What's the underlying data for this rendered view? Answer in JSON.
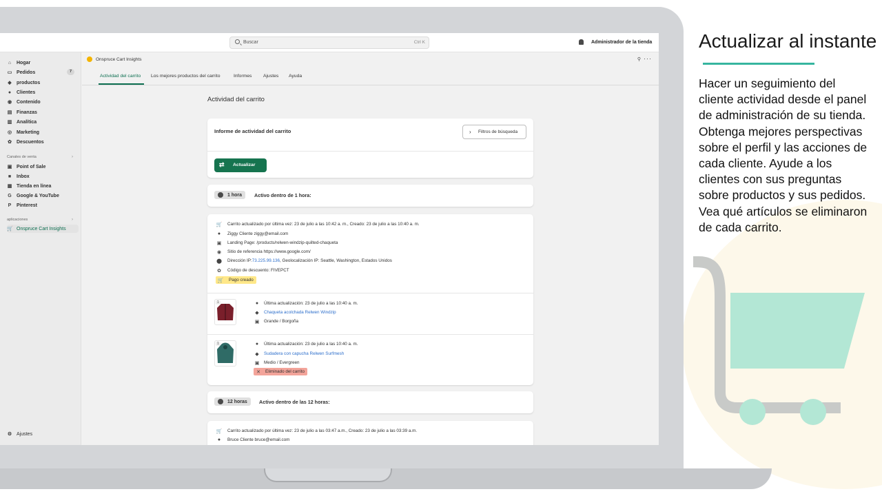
{
  "topbar": {
    "search_placeholder": "Buscar",
    "search_shortcut": "Ctrl K",
    "store_admin": "Administrador de la tienda"
  },
  "sidebar": {
    "items": [
      {
        "label": "Hogar",
        "icon": "home-icon"
      },
      {
        "label": "Pedidos",
        "icon": "orders-icon",
        "badge": "7"
      },
      {
        "label": "productos",
        "icon": "tag-icon"
      },
      {
        "label": "Clientes",
        "icon": "person-icon"
      },
      {
        "label": "Contenido",
        "icon": "content-icon"
      },
      {
        "label": "Finanzas",
        "icon": "finance-icon"
      },
      {
        "label": "Analítica",
        "icon": "analytics-icon"
      },
      {
        "label": "Marketing",
        "icon": "marketing-icon"
      },
      {
        "label": "Descuentos",
        "icon": "discount-icon"
      }
    ],
    "sales_channels_label": "Canales de venta",
    "sales_channels": [
      {
        "label": "Point of Sale",
        "icon": "pos-icon"
      },
      {
        "label": "Inbox",
        "icon": "inbox-icon"
      },
      {
        "label": "Tienda en línea",
        "icon": "store-icon"
      },
      {
        "label": "Google & YouTube",
        "icon": "google-icon"
      },
      {
        "label": "Pinterest",
        "icon": "pinterest-icon"
      }
    ],
    "apps_label": "aplicaciones",
    "apps": [
      {
        "label": "Onspruce Cart Insights",
        "icon": "cart-icon"
      }
    ],
    "settings_label": "Ajustes"
  },
  "app": {
    "name": "Onspruce Cart Insights",
    "tabs": [
      "Actividad del carrito",
      "Los mejores productos del carrito",
      "Informes",
      "Ajustes",
      "Ayuda"
    ],
    "active_tab": "Actividad del carrito"
  },
  "page": {
    "title": "Actividad del carrito",
    "report_title": "Informe de actividad del carrito",
    "filters_button": "Filtros de búsqueda",
    "update_button": "Actualizar"
  },
  "groups": [
    {
      "pill": "1 hora",
      "caption": "Activo dentro de 1 hora:"
    },
    {
      "pill": "12 horas",
      "caption": "Activo dentro de las 12 horas:"
    }
  ],
  "cart1": {
    "updated": "Carrito actualizado por última vez: 23 de julio a las 10:42 a. m., Creado: 23 de julio a las 10:40 a. m.",
    "customer": "Ziggy Cliente ziggy@email.com",
    "landing": "Landing Page: /products/relwen-windzip-quilted-chaqueta",
    "referrer": "Sitio de referencia https://www.google.com/",
    "ip_prefix": "Dirección IP: ",
    "ip": "73.225.99.136",
    "ip_suffix": ", Geolocalización IP: Seattle, Washington, Estados Unidos",
    "discount": "Código de descuento: FIVEPCT",
    "checkout": "Pago creado",
    "products": [
      {
        "qty": "1",
        "updated": "Última actualización: 23 de julio a las 10:40 a. m.",
        "name": "Chaqueta acolchada Relwen Windzip",
        "variant": "Grande / Borgoña",
        "color": "#7a1f2b"
      },
      {
        "qty": "1",
        "updated": "Última actualización: 23 de julio a las 10:40 a. m.",
        "name": "Sudadera con capucha Relwen Surfmesh",
        "variant": "Medio / Evergreen",
        "removed": "Eliminado del carrito",
        "color": "#2f6b66"
      }
    ]
  },
  "cart2": {
    "updated": "Carrito actualizado por última vez: 23 de julio a las 03:47 a.m., Creado: 23 de julio a las 03:39 a.m.",
    "customer": "Bruce Cliente bruce@email.com"
  },
  "panel": {
    "headline": "Actualizar al instante",
    "body": "Hacer un seguimiento del cliente actividad desde el panel de administración de su tienda. Obtenga mejores perspectivas sobre el perfil y las acciones de cada cliente. Ayude a los clientes con sus preguntas sobre productos y sus pedidos. Vea qué artículos se eliminaron de cada carrito.",
    "accent": "#36b59f"
  }
}
